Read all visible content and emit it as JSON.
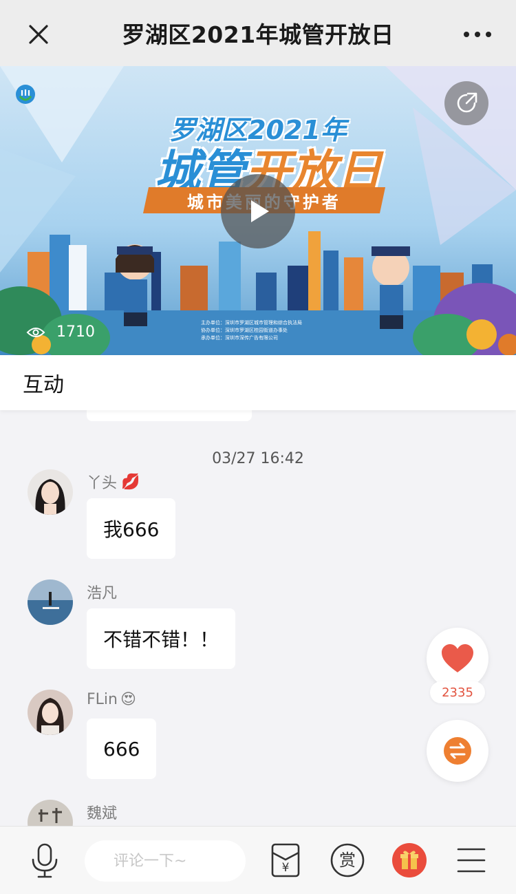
{
  "header": {
    "title": "罗湖区2021年城管开放日"
  },
  "banner": {
    "title_line1": "罗湖区2021年",
    "title_line2_part1": "城管",
    "title_line2_part2": "开放日",
    "ribbon": "城市美丽的守护者",
    "credits": [
      "主办单位：深圳市罗湖区城市管理和综合执法局",
      "协办单位：深圳市罗湖区桂园街道办事处",
      "承办单位：深圳市深传广告有限公司"
    ],
    "view_count": "1710",
    "colors": {
      "accent_blue": "#2a8fd6",
      "accent_orange": "#e8852e"
    }
  },
  "tabs": {
    "interaction": "互动"
  },
  "chat": {
    "timestamp": "03/27 16:42",
    "messages": [
      {
        "name": "丫头",
        "emoji": "💋",
        "text": "我666",
        "avatar": "avatar-girl-dark-hair"
      },
      {
        "name": "浩凡",
        "emoji": "",
        "text": "不错不错！！",
        "avatar": "avatar-lake-paddleboard"
      },
      {
        "name": "FLin",
        "emoji": "😍",
        "text": "666",
        "avatar": "avatar-girl-selfie"
      },
      {
        "name": "魏斌",
        "emoji": "",
        "text": "",
        "avatar": "avatar-calligraphy"
      }
    ]
  },
  "floating": {
    "like_count": "2335",
    "like_icon": "heart-icon",
    "switch_icon": "swap-arrows-icon"
  },
  "bottombar": {
    "comment_placeholder": "评论一下~",
    "icons": [
      "microphone-icon",
      "red-envelope-icon",
      "reward-icon",
      "gift-icon",
      "menu-icon"
    ],
    "reward_label": "赏",
    "envelope_symbol": "¥"
  }
}
